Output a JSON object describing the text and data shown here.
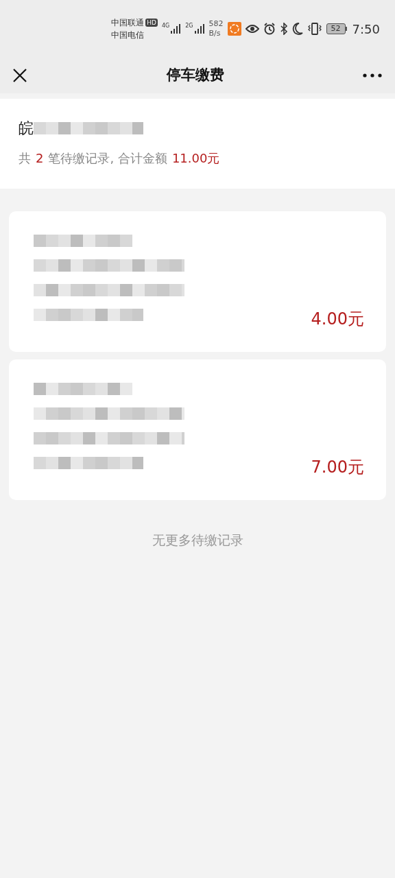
{
  "status_bar": {
    "carrier_1": "中国联通",
    "hd_badge": "HD",
    "carrier_2": "中国电信",
    "network_1": "4G",
    "network_2": "2G",
    "speed_value": "582",
    "speed_unit": "B/s",
    "battery": "52",
    "time": "7:50"
  },
  "nav_bar": {
    "title": "停车缴费"
  },
  "vehicle": {
    "plate_visible": "皖",
    "summary_prefix": "共",
    "count": "2",
    "summary_middle": "笔待缴记录, 合计金额",
    "total": "11.00元"
  },
  "records": [
    {
      "amount": "4.00元"
    },
    {
      "amount": "7.00元"
    }
  ],
  "footer": "无更多待缴记录"
}
